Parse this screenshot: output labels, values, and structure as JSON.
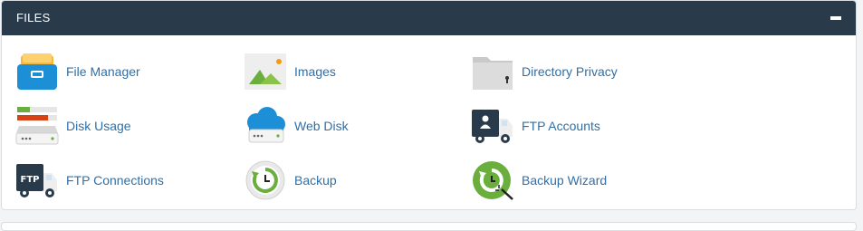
{
  "panel": {
    "title": "FILES",
    "collapse_icon": "minus-icon"
  },
  "items": [
    {
      "label": "File Manager",
      "icon": "file-manager-icon"
    },
    {
      "label": "Images",
      "icon": "images-icon"
    },
    {
      "label": "Directory Privacy",
      "icon": "directory-privacy-icon"
    },
    {
      "label": "Disk Usage",
      "icon": "disk-usage-icon"
    },
    {
      "label": "Web Disk",
      "icon": "web-disk-icon"
    },
    {
      "label": "FTP Accounts",
      "icon": "ftp-accounts-icon"
    },
    {
      "label": "FTP Connections",
      "icon": "ftp-connections-icon"
    },
    {
      "label": "Backup",
      "icon": "backup-icon"
    },
    {
      "label": "Backup Wizard",
      "icon": "backup-wizard-icon"
    }
  ],
  "colors": {
    "header_bg": "#293a4a",
    "link": "#2f6fa8",
    "accent_green": "#6aaf3d",
    "accent_blue": "#1c8fd6"
  }
}
